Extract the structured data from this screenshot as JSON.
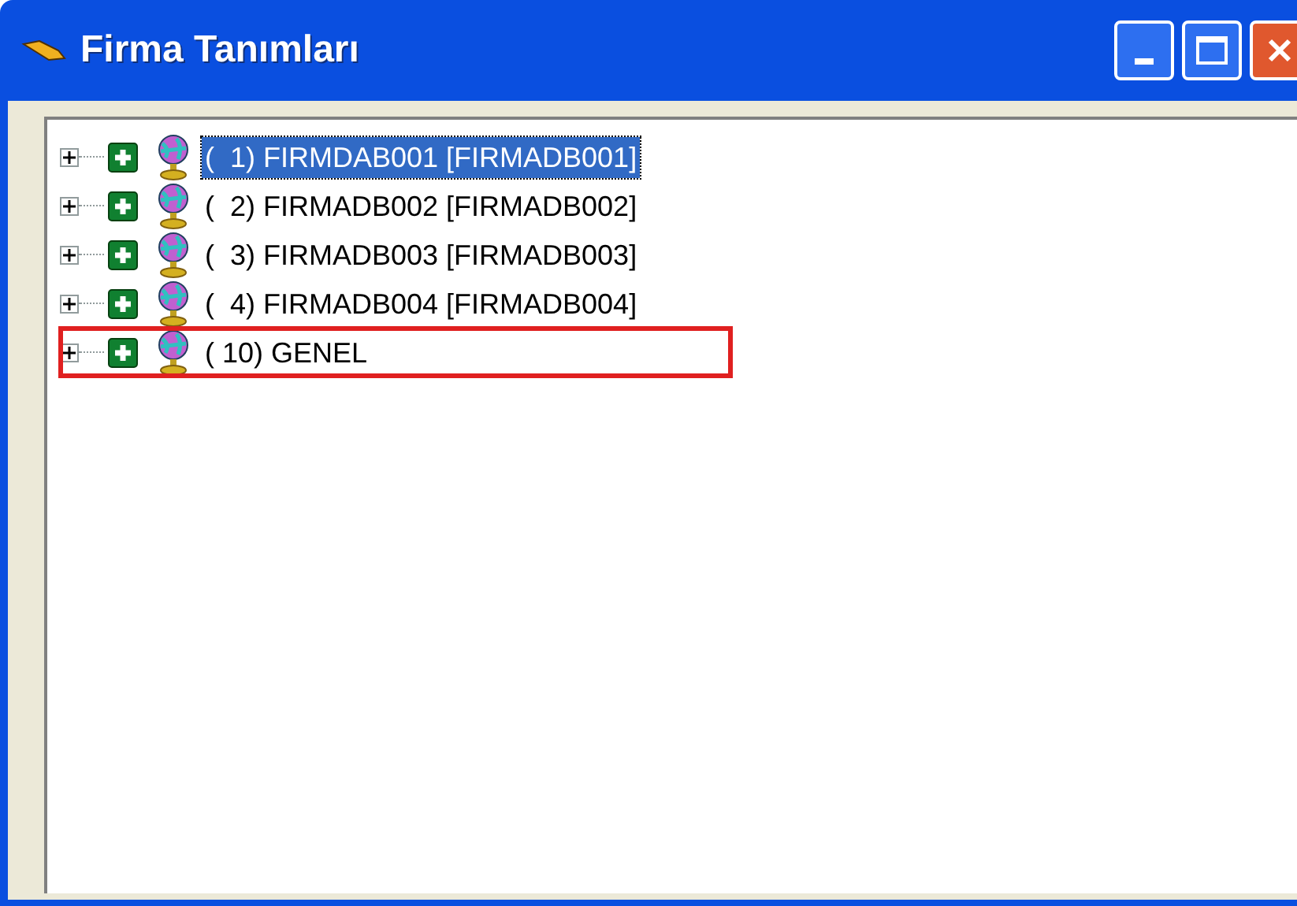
{
  "window": {
    "title": "Firma Tanımları"
  },
  "tree": {
    "items": [
      {
        "label": "(  1) FIRMDAB001 [FIRMADB001]",
        "selected": true,
        "highlighted": false
      },
      {
        "label": "(  2) FIRMADB002 [FIRMADB002]",
        "selected": false,
        "highlighted": false
      },
      {
        "label": "(  3) FIRMADB003 [FIRMADB003]",
        "selected": false,
        "highlighted": false
      },
      {
        "label": "(  4) FIRMADB004 [FIRMADB004]",
        "selected": false,
        "highlighted": false
      },
      {
        "label": "( 10) GENEL",
        "selected": false,
        "highlighted": true
      }
    ]
  }
}
